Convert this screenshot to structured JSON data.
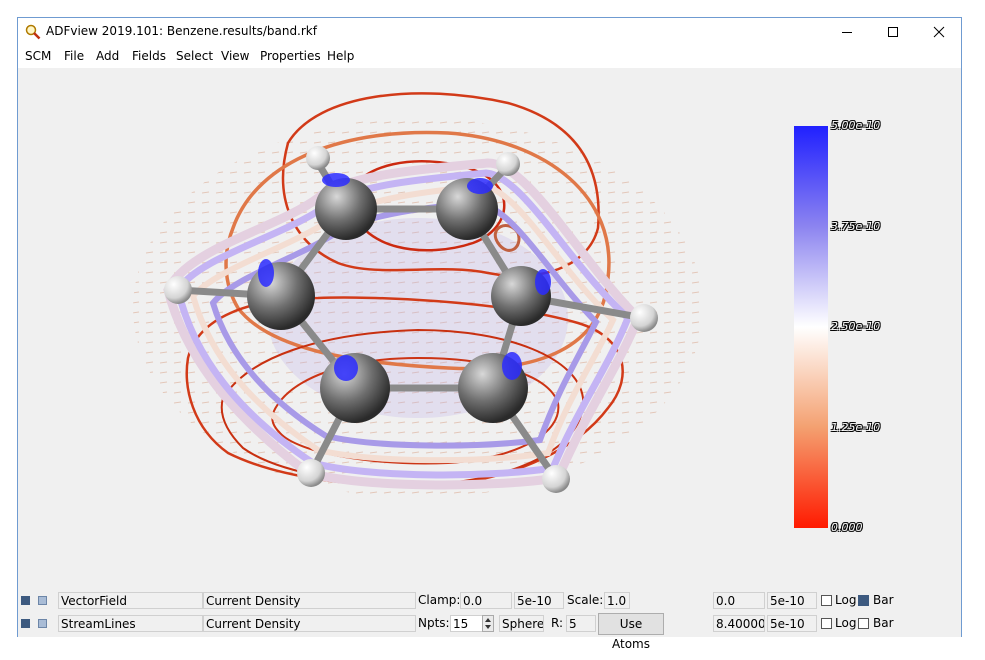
{
  "window": {
    "title": "ADFview 2019.101: Benzene.results/band.rkf",
    "minimize_icon": "minimize-icon",
    "maximize_icon": "maximize-icon",
    "close_icon": "close-icon"
  },
  "menu": [
    "SCM",
    "File",
    "Add",
    "Fields",
    "Select",
    "View",
    "Properties",
    "Help"
  ],
  "colorbar": {
    "labels": [
      "5.00e-10",
      "3.75e-10",
      "2.50e-10",
      "1.25e-10",
      "0.000"
    ],
    "colors": {
      "top": "#2222ff",
      "mid": "#ffffff",
      "bottom": "#ff1a00"
    }
  },
  "rows": [
    {
      "type": "VectorField",
      "field": "Current Density",
      "p1_label": "Clamp:",
      "p1_value": "0.0",
      "p2_value": "5e-10",
      "p3_label": "Scale:",
      "p3_value": "1.0",
      "range_min": "0.0",
      "range_max": "5e-10",
      "log_label": "Log",
      "log_checked": false,
      "bar_label": "Bar",
      "bar_checked": true
    },
    {
      "type": "StreamLines",
      "field": "Current Density",
      "p1_label": "Npts:",
      "p1_value": "15",
      "shape": "Sphere",
      "r_label": "R:",
      "r_value": "5",
      "button_label": "Use Atoms",
      "range_min": "8.400000",
      "range_max": "5e-10",
      "log_label": "Log",
      "log_checked": false,
      "bar_label": "Bar",
      "bar_checked": false
    }
  ]
}
